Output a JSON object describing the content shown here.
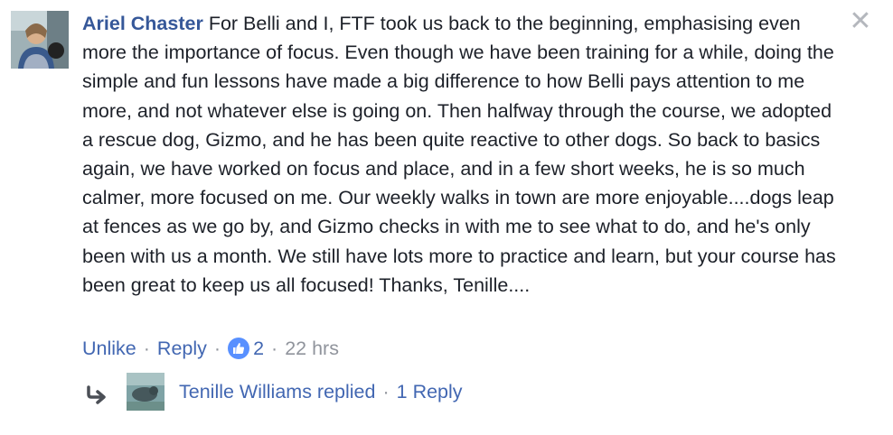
{
  "comment": {
    "author": "Ariel Chaster",
    "text": "For Belli and I, FTF took us back to the beginning, emphasising even more the importance of focus. Even though we have been training for a while, doing the simple and fun lessons have made a big difference to how Belli pays attention to me more, and not whatever else is going on. Then halfway through the course, we adopted a rescue dog, Gizmo, and he has been quite reactive to other dogs. So back to basics again, we have worked on focus and place, and in a few short weeks, he is so much calmer, more focused on me. Our weekly walks in town are more enjoyable....dogs leap at fences as we go by, and Gizmo checks in with me to see what to do, and he's only been with us a month. We still have lots more to practice and learn, but your course has been great to keep us all focused! Thanks, Tenille....",
    "close_symbol": "✕",
    "close_icon": "close-icon"
  },
  "actions": {
    "unlike_label": "Unlike",
    "reply_label": "Reply",
    "separator": "·",
    "like_count": "2",
    "like_icon": "thumbs-up-icon",
    "timestamp": "22 hrs"
  },
  "reply_summary": {
    "name_text": "Tenille Williams replied",
    "separator": "·",
    "count_text": "1 Reply",
    "arrow_icon": "reply-arrow-icon"
  },
  "colors": {
    "link": "#365899",
    "action_link": "#4267b2",
    "muted": "#90949c",
    "text": "#1d2129",
    "like_badge": "#4267b2"
  }
}
